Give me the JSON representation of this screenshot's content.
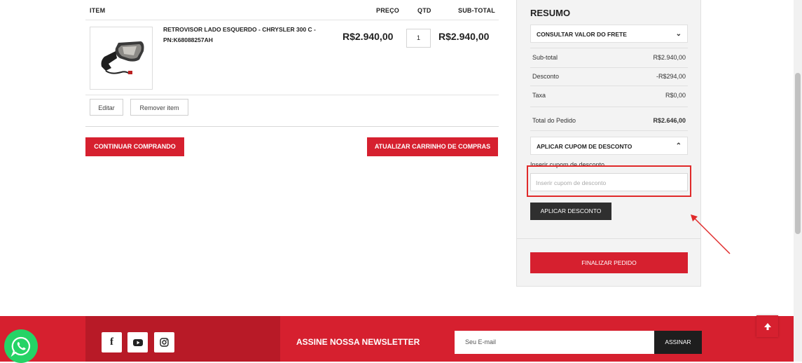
{
  "cart": {
    "headers": {
      "item": "ITEM",
      "price": "PREÇO",
      "qty": "QTD",
      "subtotal": "SUB-TOTAL"
    },
    "items": [
      {
        "name": "RETROVISOR LADO ESQUERDO - CHRYSLER 300 C - PN:K68088257AH",
        "price": "R$2.940,00",
        "qty": "1",
        "subtotal": "R$2.940,00"
      }
    ],
    "edit_label": "Editar",
    "remove_label": "Remover item",
    "continue_label": "CONTINUAR COMPRANDO",
    "update_label": "ATUALIZAR CARRINHO DE COMPRAS"
  },
  "summary": {
    "title": "RESUMO",
    "shipping_label": "CONSULTAR VALOR DO FRETE",
    "rows": [
      {
        "label": "Sub-total",
        "value": "R$2.940,00"
      },
      {
        "label": "Desconto",
        "value": "-R$294,00"
      },
      {
        "label": "Taxa",
        "value": "R$0,00"
      }
    ],
    "total_label": "Total do Pedido",
    "total_value": "R$2.646,00",
    "coupon_header": "APLICAR CUPOM DE DESCONTO",
    "coupon_label": "Inserir cupom de desconto",
    "coupon_placeholder": "Inserir cupom de desconto",
    "apply_label": "APLICAR DESCONTO",
    "finalize_label": "FINALIZAR PEDIDO"
  },
  "footer": {
    "newsletter_label": "ASSINE NOSSA NEWSLETTER",
    "email_placeholder": "Seu E-mail",
    "subscribe_label": "ASSINAR",
    "social_icons": [
      "facebook-icon",
      "youtube-icon",
      "instagram-icon"
    ]
  },
  "colors": {
    "brand_red": "#d6202f",
    "dark": "#2f2f2f",
    "whatsapp_green": "#25d366",
    "highlight": "#e02a2a"
  }
}
